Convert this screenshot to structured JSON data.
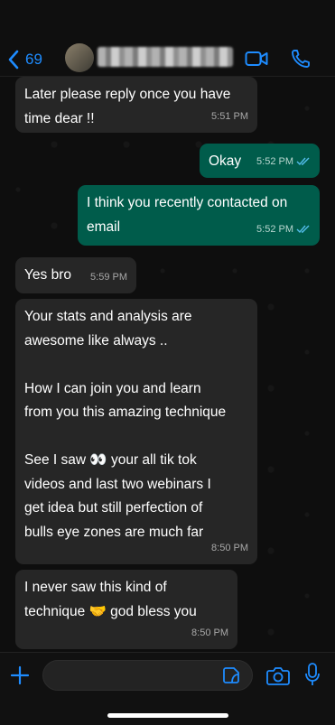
{
  "header": {
    "back_count": "69"
  },
  "messages": [
    {
      "dir": "in",
      "text": "Later please reply once you have\ntime dear !!",
      "time": "5:51 PM"
    },
    {
      "dir": "out",
      "text": "Okay",
      "time": "5:52 PM",
      "status": "read"
    },
    {
      "dir": "out",
      "text": "I think you recently contacted on\nemail",
      "time": "5:52 PM",
      "status": "read"
    },
    {
      "dir": "in",
      "text": "Yes bro",
      "time": "5:59 PM"
    },
    {
      "dir": "in",
      "text": "Your stats and analysis are\nawesome like always ..\n\nHow I can join you and learn\nfrom you this amazing technique\n\nSee I saw 👀 your all tik tok\nvideos and last two webinars I\nget idea but still perfection of\nbulls eye zones are much far",
      "time": "8:50 PM"
    },
    {
      "dir": "in",
      "text": "I never saw this kind of\ntechnique 🤝 god bless you",
      "time": "8:50 PM"
    }
  ],
  "colors": {
    "accent": "#1e8cff",
    "incoming_bubble": "#262626",
    "outgoing_bubble": "#005c4b",
    "read_ticks": "#53bdeb"
  },
  "icons": {
    "back": "chevron-left-icon",
    "video": "video-call-icon",
    "phone": "phone-icon",
    "plus": "plus-icon",
    "sticker": "sticker-icon",
    "camera": "camera-icon",
    "mic": "mic-icon"
  }
}
